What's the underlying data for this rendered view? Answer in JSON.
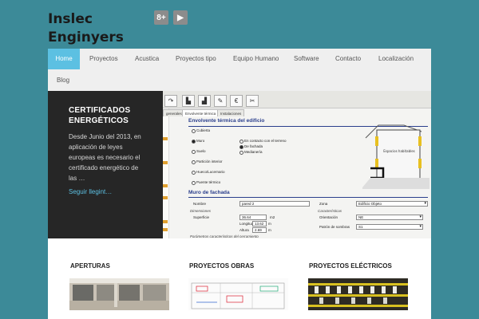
{
  "site": {
    "title_line1": "Inslec",
    "title_line2": "Enginyers"
  },
  "social": [
    {
      "icon": "google-plus-icon",
      "glyph": "8+"
    },
    {
      "icon": "youtube-icon",
      "glyph": "▶"
    }
  ],
  "nav": {
    "items": [
      "Home",
      "Proyectos",
      "Acustica",
      "Proyectos tipo",
      "Equipo Humano",
      "Software",
      "Contacto",
      "Localización",
      "Blog"
    ],
    "active": "Home"
  },
  "hero": {
    "title": "CERTIFICADOS ENERGÉTICOS",
    "text": "Desde Junio del 2013, en aplicación de leyes europeas es necesario el certificado energético de las …",
    "link": "Seguir llegint…"
  },
  "software": {
    "tabs": [
      "generales",
      "Envolvente térmica",
      "Instalaciones"
    ],
    "section_title": "Envolvente térmica del edificio",
    "radio_col1": [
      "Cubierta",
      "Muro",
      "Suelo",
      "Partición interior",
      "Hueco/Lucernario",
      "Puente térmico"
    ],
    "radio_col2": [
      "En contacto con el terreno",
      "De fachada",
      "Medianería"
    ],
    "diagram_label": "Espacios habitables",
    "section2_title": "Muro de fachada",
    "nombre_label": "Nombre",
    "nombre_value": "pared 2",
    "zona_label": "Zona",
    "zona_value": "Edificio Objeto",
    "dimensiones_label": "Dimensiones",
    "superficie_label": "Superficie",
    "superficie_value": "36.64",
    "superficie_unit": "m2",
    "longitud_label": "Longitud",
    "longitud_value": "13.62",
    "altura_label": "Altura",
    "altura_value": "2.69",
    "caracteristicas_label": "Características",
    "orientacion_label": "Orientación",
    "orientacion_value": "NE",
    "patron_label": "Patrón de sombras",
    "patron_value": "S1",
    "footer_text": "Parámetros característicos del cerramiento"
  },
  "columns": [
    {
      "title": "APERTURAS"
    },
    {
      "title": "PROYECTOS OBRAS"
    },
    {
      "title": "PROYECTOS ELÉCTRICOS"
    }
  ]
}
